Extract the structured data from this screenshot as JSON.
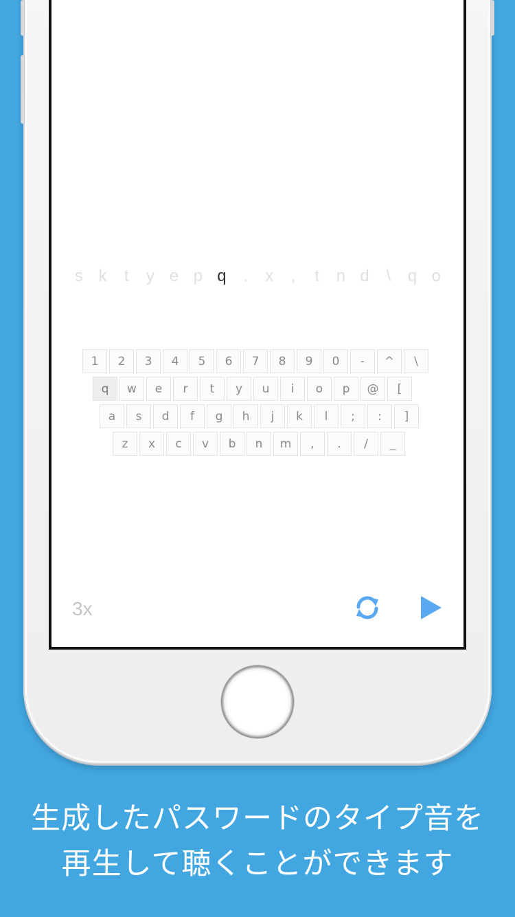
{
  "password": {
    "chars": [
      "s",
      "k",
      "t",
      "y",
      "e",
      "p",
      "q",
      ".",
      "x",
      ",",
      "t",
      "n",
      "d",
      "\\",
      "q",
      "o"
    ],
    "active_index": 6
  },
  "keyboard": {
    "rows": [
      [
        "1",
        "2",
        "3",
        "4",
        "5",
        "6",
        "7",
        "8",
        "9",
        "0",
        "-",
        "^",
        "\\"
      ],
      [
        "q",
        "w",
        "e",
        "r",
        "t",
        "y",
        "u",
        "i",
        "o",
        "p",
        "@",
        "["
      ],
      [
        "a",
        "s",
        "d",
        "f",
        "g",
        "h",
        "j",
        "k",
        "l",
        ";",
        ":",
        "]"
      ],
      [
        "z",
        "x",
        "c",
        "v",
        "b",
        "n",
        "m",
        ",",
        ".",
        "/",
        "_"
      ]
    ],
    "pressed_key": "q"
  },
  "controls": {
    "speed_label": "3x",
    "refresh_icon": "refresh-icon",
    "play_icon": "play-icon",
    "accent_color": "#5aa9f0"
  },
  "caption": {
    "line1": "生成したパスワードのタイプ音を",
    "line2": "再生して聴くことができます"
  },
  "colors": {
    "background": "#42a6e0"
  }
}
